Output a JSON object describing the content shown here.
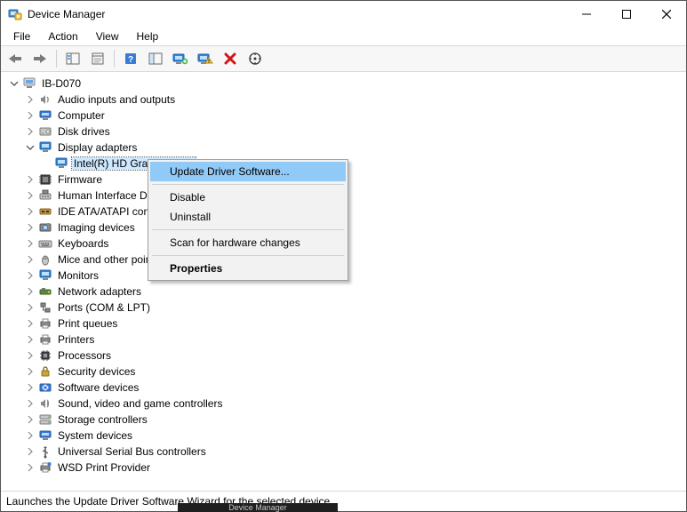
{
  "window": {
    "title": "Device Manager"
  },
  "menubar": {
    "file": "File",
    "action": "Action",
    "view": "View",
    "help": "Help"
  },
  "tree": {
    "root": {
      "label": "IB-D070",
      "expanded": true
    },
    "nodes": [
      {
        "label": "Audio inputs and outputs",
        "expanded": false
      },
      {
        "label": "Computer",
        "expanded": false
      },
      {
        "label": "Disk drives",
        "expanded": false
      },
      {
        "label": "Display adapters",
        "expanded": true,
        "children": [
          {
            "label": "Intel(R) HD Graphics 530",
            "selected": true
          }
        ]
      },
      {
        "label": "Firmware",
        "expanded": false
      },
      {
        "label": "Human Interface Devices",
        "expanded": false
      },
      {
        "label": "IDE ATA/ATAPI controllers",
        "expanded": false
      },
      {
        "label": "Imaging devices",
        "expanded": false
      },
      {
        "label": "Keyboards",
        "expanded": false
      },
      {
        "label": "Mice and other pointing devices",
        "expanded": false
      },
      {
        "label": "Monitors",
        "expanded": false
      },
      {
        "label": "Network adapters",
        "expanded": false
      },
      {
        "label": "Ports (COM & LPT)",
        "expanded": false
      },
      {
        "label": "Print queues",
        "expanded": false
      },
      {
        "label": "Printers",
        "expanded": false
      },
      {
        "label": "Processors",
        "expanded": false
      },
      {
        "label": "Security devices",
        "expanded": false
      },
      {
        "label": "Software devices",
        "expanded": false
      },
      {
        "label": "Sound, video and game controllers",
        "expanded": false
      },
      {
        "label": "Storage controllers",
        "expanded": false
      },
      {
        "label": "System devices",
        "expanded": false
      },
      {
        "label": "Universal Serial Bus controllers",
        "expanded": false
      },
      {
        "label": "WSD Print Provider",
        "expanded": false
      }
    ]
  },
  "context_menu": {
    "update": "Update Driver Software...",
    "disable": "Disable",
    "uninstall": "Uninstall",
    "scan": "Scan for hardware changes",
    "properties": "Properties"
  },
  "statusbar": {
    "text": "Launches the Update Driver Software Wizard for the selected device."
  },
  "stray": {
    "label": "Device Manager"
  }
}
